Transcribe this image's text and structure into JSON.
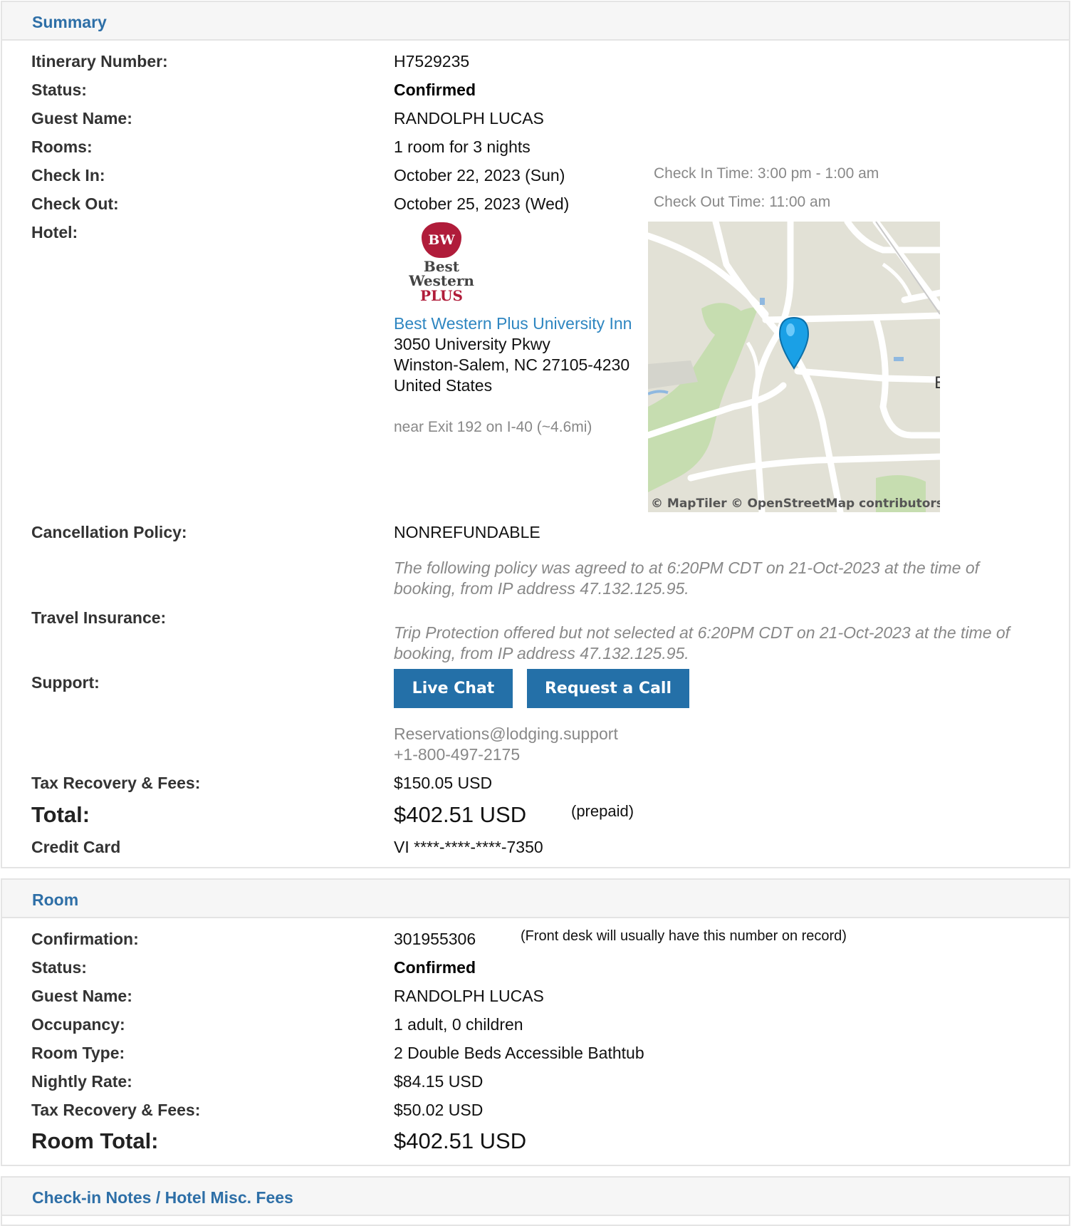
{
  "summary": {
    "title": "Summary",
    "labels": {
      "itinerary": "Itinerary Number:",
      "status": "Status:",
      "guest": "Guest Name:",
      "rooms": "Rooms:",
      "checkin": "Check In:",
      "checkout": "Check Out:",
      "hotel": "Hotel:",
      "cancellation": "Cancellation Policy:",
      "insurance": "Travel Insurance:",
      "support": "Support:",
      "tax": "Tax Recovery & Fees:",
      "total": "Total:",
      "card": "Credit Card"
    },
    "itinerary_number": "H7529235",
    "status": "Confirmed",
    "guest_name": "RANDOLPH LUCAS",
    "rooms": "1 room for 3 nights",
    "check_in": "October 22, 2023 (Sun)",
    "check_in_time": "Check In Time: 3:00 pm - 1:00 am",
    "check_out": "October 25, 2023 (Wed)",
    "check_out_time": "Check Out Time: 11:00 am",
    "hotel": {
      "logo_line1": "BW",
      "logo_line2": "Best",
      "logo_line3": "Western",
      "logo_line4": "PLUS",
      "name": "Best Western Plus University Inn",
      "address1": "3050 University Pkwy",
      "address2": "Winston-Salem, NC 27105-4230",
      "country": "United States",
      "nearby": "near Exit 192 on I-40 (~4.6mi)",
      "map_attribution": "© MapTiler © OpenStreetMap contributors",
      "map_edge_text": "E"
    },
    "cancellation_policy": "NONREFUNDABLE",
    "cancellation_note": "The following policy was agreed to at 6:20PM CDT on 21-Oct-2023 at the time of booking, from IP address 47.132.125.95.",
    "insurance_note": "Trip Protection offered but not selected at 6:20PM CDT on 21-Oct-2023 at the time of booking, from IP address 47.132.125.95.",
    "support": {
      "live_chat": "Live Chat",
      "request_call": "Request a Call",
      "email": "Reservations@lodging.support",
      "phone": "+1-800-497-2175"
    },
    "tax_fees": "$150.05 USD",
    "total": "$402.51 USD",
    "total_note": "(prepaid)",
    "credit_card": "VI ****-****-****-7350"
  },
  "room": {
    "title": "Room",
    "labels": {
      "confirmation": "Confirmation:",
      "status": "Status:",
      "guest": "Guest Name:",
      "occupancy": "Occupancy:",
      "room_type": "Room Type:",
      "nightly": "Nightly Rate:",
      "tax": "Tax Recovery & Fees:",
      "total": "Room Total:"
    },
    "confirmation": "301955306",
    "confirmation_note": "(Front desk will usually have this number on record)",
    "status": "Confirmed",
    "guest_name": "RANDOLPH LUCAS",
    "occupancy": "1 adult, 0 children",
    "room_type": "2 Double Beds Accessible Bathtub",
    "nightly_rate": "$84.15 USD",
    "tax_fees": "$50.02 USD",
    "room_total": "$402.51 USD"
  },
  "notes": {
    "title": "Check-in Notes / Hotel Misc. Fees"
  },
  "colors": {
    "accent": "#2e6fa7",
    "button": "#2470a8",
    "link": "#2e86c1",
    "muted": "#888888"
  }
}
